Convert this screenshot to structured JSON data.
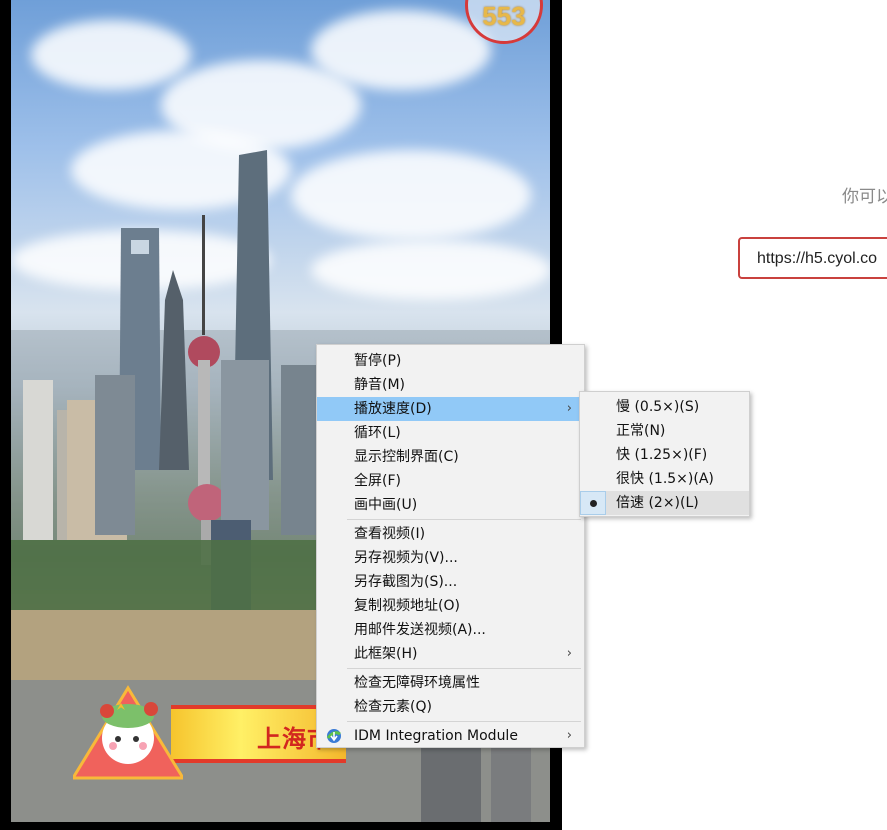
{
  "video": {
    "counter": "553",
    "banner_text": "上海市"
  },
  "page": {
    "hint_text": "你可以",
    "url_value": "https://h5.cyol.co"
  },
  "context_menu": {
    "items": [
      {
        "label": "暂停(P)"
      },
      {
        "label": "静音(M)"
      },
      {
        "label": "播放速度(D)"
      },
      {
        "label": "循环(L)"
      },
      {
        "label": "显示控制界面(C)"
      },
      {
        "label": "全屏(F)"
      },
      {
        "label": "画中画(U)"
      },
      {
        "label": "查看视频(I)"
      },
      {
        "label": "另存视频为(V)..."
      },
      {
        "label": "另存截图为(S)..."
      },
      {
        "label": "复制视频地址(O)"
      },
      {
        "label": "用邮件发送视频(A)..."
      },
      {
        "label": "此框架(H)"
      },
      {
        "label": "检查无障碍环境属性"
      },
      {
        "label": "检查元素(Q)"
      },
      {
        "label": "IDM Integration Module"
      }
    ],
    "arrow_glyph": "›"
  },
  "speed_submenu": {
    "items": [
      {
        "label": "慢 (0.5×)(S)"
      },
      {
        "label": "正常(N)"
      },
      {
        "label": "快 (1.25×)(F)"
      },
      {
        "label": "很快 (1.5×)(A)"
      },
      {
        "label": "倍速 (2×)(L)"
      }
    ],
    "selected": "倍速 (2×)(L)"
  },
  "colors": {
    "highlight": "#91c9f7",
    "url_border": "#c9413e",
    "menu_bg": "#f2f2f2"
  },
  "icons": [
    "idm-icon",
    "submenu-arrow-icon",
    "radio-bullet-icon"
  ]
}
